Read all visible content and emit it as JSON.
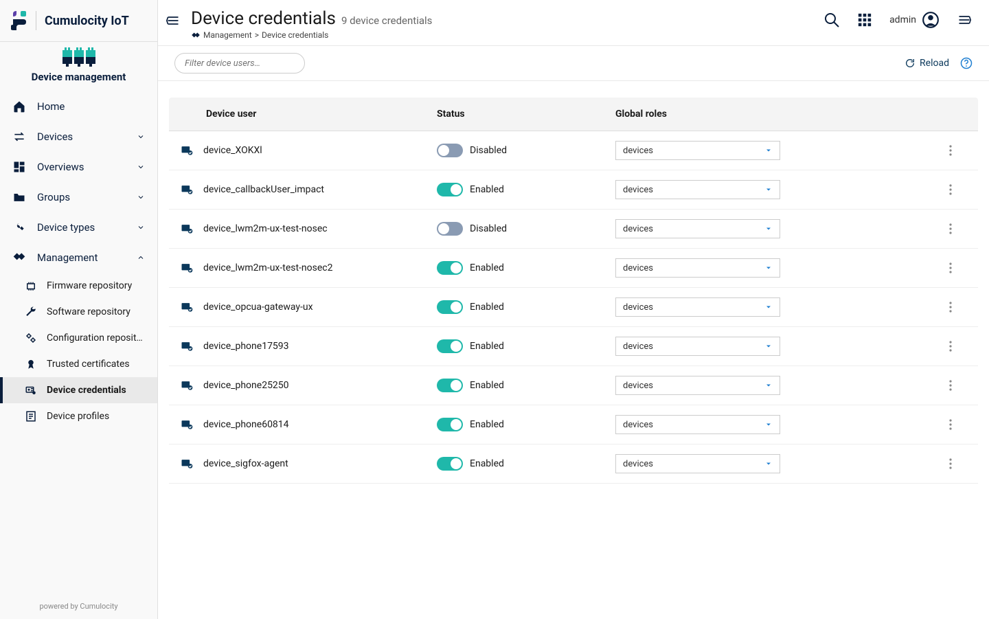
{
  "brand": {
    "title": "Cumulocity IoT"
  },
  "app": {
    "label": "Device management"
  },
  "sidebar": {
    "items": [
      {
        "label": "Home",
        "icon": "home",
        "expandable": false
      },
      {
        "label": "Devices",
        "icon": "swap",
        "expandable": true
      },
      {
        "label": "Overviews",
        "icon": "dashboard",
        "expandable": true
      },
      {
        "label": "Groups",
        "icon": "folder",
        "expandable": true
      },
      {
        "label": "Device types",
        "icon": "tools",
        "expandable": true
      },
      {
        "label": "Management",
        "icon": "handshake",
        "expandable": true,
        "expanded": true
      }
    ],
    "management_children": [
      {
        "label": "Firmware repository",
        "icon": "chip"
      },
      {
        "label": "Software repository",
        "icon": "wrench"
      },
      {
        "label": "Configuration reposito…",
        "icon": "gears"
      },
      {
        "label": "Trusted certificates",
        "icon": "badge"
      },
      {
        "label": "Device credentials",
        "icon": "credentials",
        "active": true
      },
      {
        "label": "Device profiles",
        "icon": "profile"
      }
    ]
  },
  "footer": "powered by Cumulocity",
  "header": {
    "title": "Device credentials",
    "subtitle": "9 device credentials",
    "breadcrumb": [
      "Management",
      "Device credentials"
    ],
    "user": "admin"
  },
  "toolbar": {
    "filter_placeholder": "Filter device users…",
    "reload_label": "Reload"
  },
  "table": {
    "headers": {
      "user": "Device user",
      "status": "Status",
      "roles": "Global roles"
    },
    "status_labels": {
      "enabled": "Enabled",
      "disabled": "Disabled"
    },
    "role_default": "devices",
    "rows": [
      {
        "user": "device_XOKXl",
        "enabled": false,
        "role": "devices"
      },
      {
        "user": "device_callbackUser_impact",
        "enabled": true,
        "role": "devices"
      },
      {
        "user": "device_lwm2m-ux-test-nosec",
        "enabled": false,
        "role": "devices"
      },
      {
        "user": "device_lwm2m-ux-test-nosec2",
        "enabled": true,
        "role": "devices"
      },
      {
        "user": "device_opcua-gateway-ux",
        "enabled": true,
        "role": "devices"
      },
      {
        "user": "device_phone17593",
        "enabled": true,
        "role": "devices"
      },
      {
        "user": "device_phone25250",
        "enabled": true,
        "role": "devices"
      },
      {
        "user": "device_phone60814",
        "enabled": true,
        "role": "devices"
      },
      {
        "user": "device_sigfox-agent",
        "enabled": true,
        "role": "devices"
      }
    ]
  }
}
